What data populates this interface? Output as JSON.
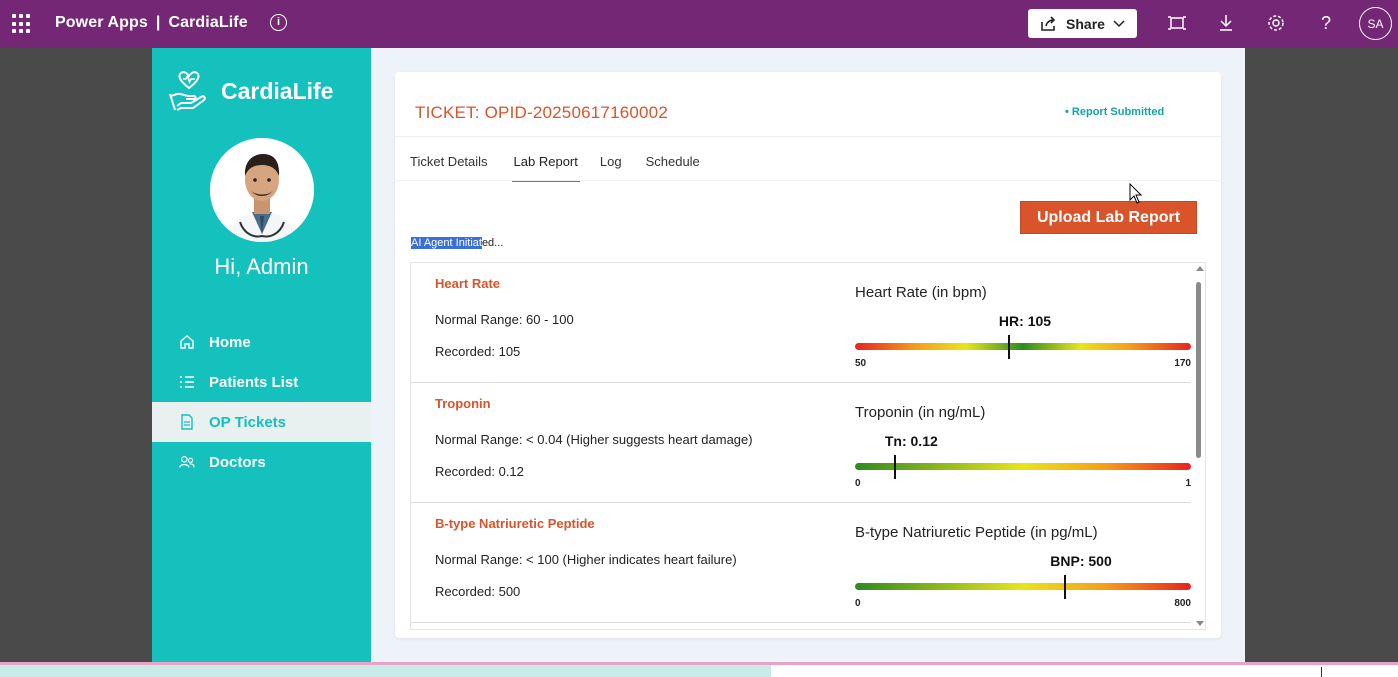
{
  "topbar": {
    "app_title": "Power Apps",
    "app_name": "CardiaLife",
    "separator": "|",
    "share_label": "Share",
    "avatar_initials": "SA",
    "icons": [
      "waffle-icon",
      "info-icon",
      "share-icon",
      "chevron-down-icon",
      "fit-screen-icon",
      "download-icon",
      "settings-icon",
      "help-icon"
    ]
  },
  "sidebar": {
    "brand": "CardiaLife",
    "greeting": "Hi, Admin",
    "items": [
      {
        "label": "Home",
        "icon": "home-icon",
        "active": false
      },
      {
        "label": "Patients List",
        "icon": "list-icon",
        "active": false
      },
      {
        "label": "OP Tickets",
        "icon": "document-icon",
        "active": true
      },
      {
        "label": "Doctors",
        "icon": "people-icon",
        "active": false
      }
    ]
  },
  "ticket": {
    "title": "TICKET: OPID-20250617160002",
    "status": "• Report Submitted",
    "tabs": [
      "Ticket Details",
      "Lab Report",
      "Log",
      "Schedule"
    ],
    "active_tab": "Lab Report",
    "upload_label": "Upload Lab Report",
    "ai_text_highlighted": "AI Agent Initiat",
    "ai_text_rest": "ed..."
  },
  "results": [
    {
      "name": "Heart Rate",
      "range": "Normal Range:  60 - 100",
      "recorded": "Recorded: 105",
      "gauge_title": "Heart Rate (in bpm)",
      "marker_label": "HR: 105",
      "min": "50",
      "max": "170",
      "min_value": 50,
      "max_value": 170,
      "value": 105,
      "scale": "hr"
    },
    {
      "name": "Troponin",
      "range": "Normal Range:  < 0.04 (Higher suggests heart damage)",
      "recorded": "Recorded: 0.12",
      "gauge_title": "Troponin (in ng/mL)",
      "marker_label": "Tn: 0.12",
      "min": "0",
      "max": "1",
      "min_value": 0,
      "max_value": 1,
      "value": 0.12,
      "scale": "asc"
    },
    {
      "name": "B-type Natriuretic Peptide",
      "range": "Normal Range:  < 100 (Higher indicates heart failure)",
      "recorded": "Recorded: 500",
      "gauge_title": "B-type Natriuretic Peptide (in pg/mL)",
      "marker_label": "BNP: 500",
      "min": "0",
      "max": "800",
      "min_value": 0,
      "max_value": 800,
      "value": 500,
      "scale": "asc"
    }
  ],
  "colors": {
    "topbar": "#742774",
    "sidebar": "#14c1bd",
    "accent": "#d9542a",
    "status": "#14a5a0"
  }
}
